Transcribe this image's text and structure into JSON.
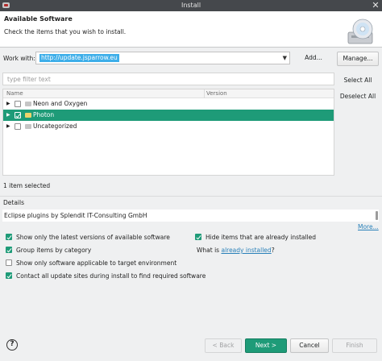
{
  "window": {
    "title": "Install"
  },
  "banner": {
    "heading": "Available Software",
    "description": "Check the items that you wish to install."
  },
  "work_with": {
    "label": "Work with:",
    "value": "http://update.jsparrow.eu",
    "add_label": "Add...",
    "manage_label": "Manage..."
  },
  "filter": {
    "placeholder": "type filter text"
  },
  "tree": {
    "columns": [
      "Name",
      "Version"
    ],
    "items": [
      {
        "label": "Neon and Oxygen",
        "checked": false,
        "selected": false
      },
      {
        "label": "Photon",
        "checked": true,
        "selected": true
      },
      {
        "label": "Uncategorized",
        "checked": false,
        "selected": false
      }
    ]
  },
  "side_buttons": {
    "select_all": "Select All",
    "deselect_all": "Deselect All"
  },
  "status": "1 item selected",
  "details": {
    "label": "Details",
    "text": "Eclipse plugins by Splendit IT-Consulting GmbH",
    "more": "More..."
  },
  "options": {
    "latest_versions": {
      "label": "Show only the latest versions of available software",
      "checked": true
    },
    "group_by_category": {
      "label": "Group items by category",
      "checked": true
    },
    "target_env": {
      "label": "Show only software applicable to target environment",
      "checked": false
    },
    "contact_sites": {
      "label": "Contact all update sites during install to find required software",
      "checked": true
    },
    "hide_installed": {
      "label": "Hide items that are already installed",
      "checked": true
    },
    "what_is_prefix": "What is ",
    "what_is_link": "already installed",
    "what_is_suffix": "?"
  },
  "footer": {
    "back": "< Back",
    "next": "Next >",
    "cancel": "Cancel",
    "finish": "Finish",
    "help_glyph": "?"
  },
  "colors": {
    "accent": "#1e9b78",
    "selection": "#3daee9",
    "titlebar": "#45484c",
    "link": "#2980b9"
  }
}
